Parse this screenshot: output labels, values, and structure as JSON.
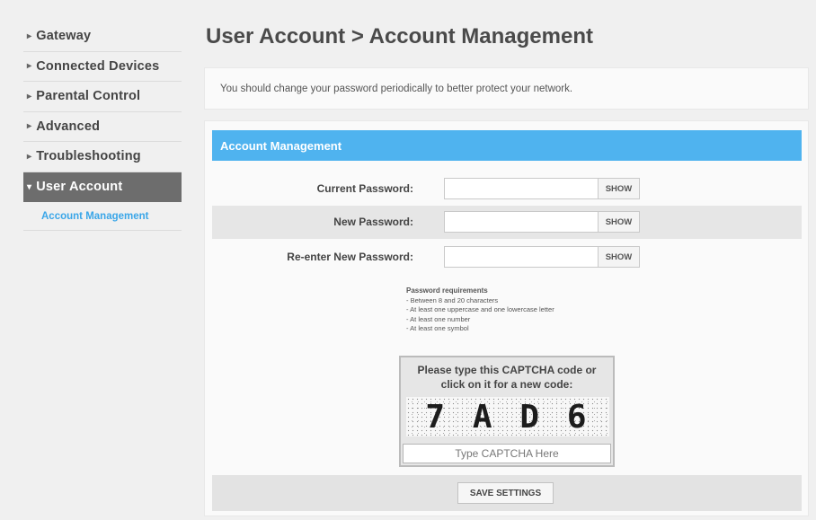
{
  "sidebar": {
    "items": [
      {
        "label": "Gateway",
        "arrow": "▸"
      },
      {
        "label": "Connected Devices",
        "arrow": "▸"
      },
      {
        "label": "Parental Control",
        "arrow": "▸"
      },
      {
        "label": "Advanced",
        "arrow": "▸"
      },
      {
        "label": "Troubleshooting",
        "arrow": "▸"
      },
      {
        "label": "User Account",
        "arrow": "▾"
      }
    ],
    "sub_item": "Account Management",
    "active_color": "#6d6d6d",
    "sub_item_color": "#3aa6e8"
  },
  "header": {
    "title": "User Account > Account Management"
  },
  "notice": {
    "text": "You should change your password periodically to better protect your network."
  },
  "panel": {
    "title": "Account Management",
    "header_color": "#4fb3ef",
    "fields": [
      {
        "label": "Current Password:",
        "value": "",
        "show_label": "SHOW"
      },
      {
        "label": "New Password:",
        "value": "",
        "show_label": "SHOW"
      },
      {
        "label": "Re-enter New Password:",
        "value": "",
        "show_label": "SHOW"
      }
    ],
    "requirements": {
      "title": "Password requirements",
      "lines": [
        "- Between 8 and 20 characters",
        "- At least one uppercase and one lowercase letter",
        "- At least one number",
        "- At least one symbol"
      ]
    },
    "captcha": {
      "prompt_line1": "Please type this CAPTCHA code or",
      "prompt_line2": "click on it for a new code:",
      "chars": [
        "7",
        "A",
        "D",
        "6"
      ],
      "placeholder": "Type CAPTCHA Here",
      "value": ""
    },
    "save_label": "SAVE SETTINGS"
  }
}
